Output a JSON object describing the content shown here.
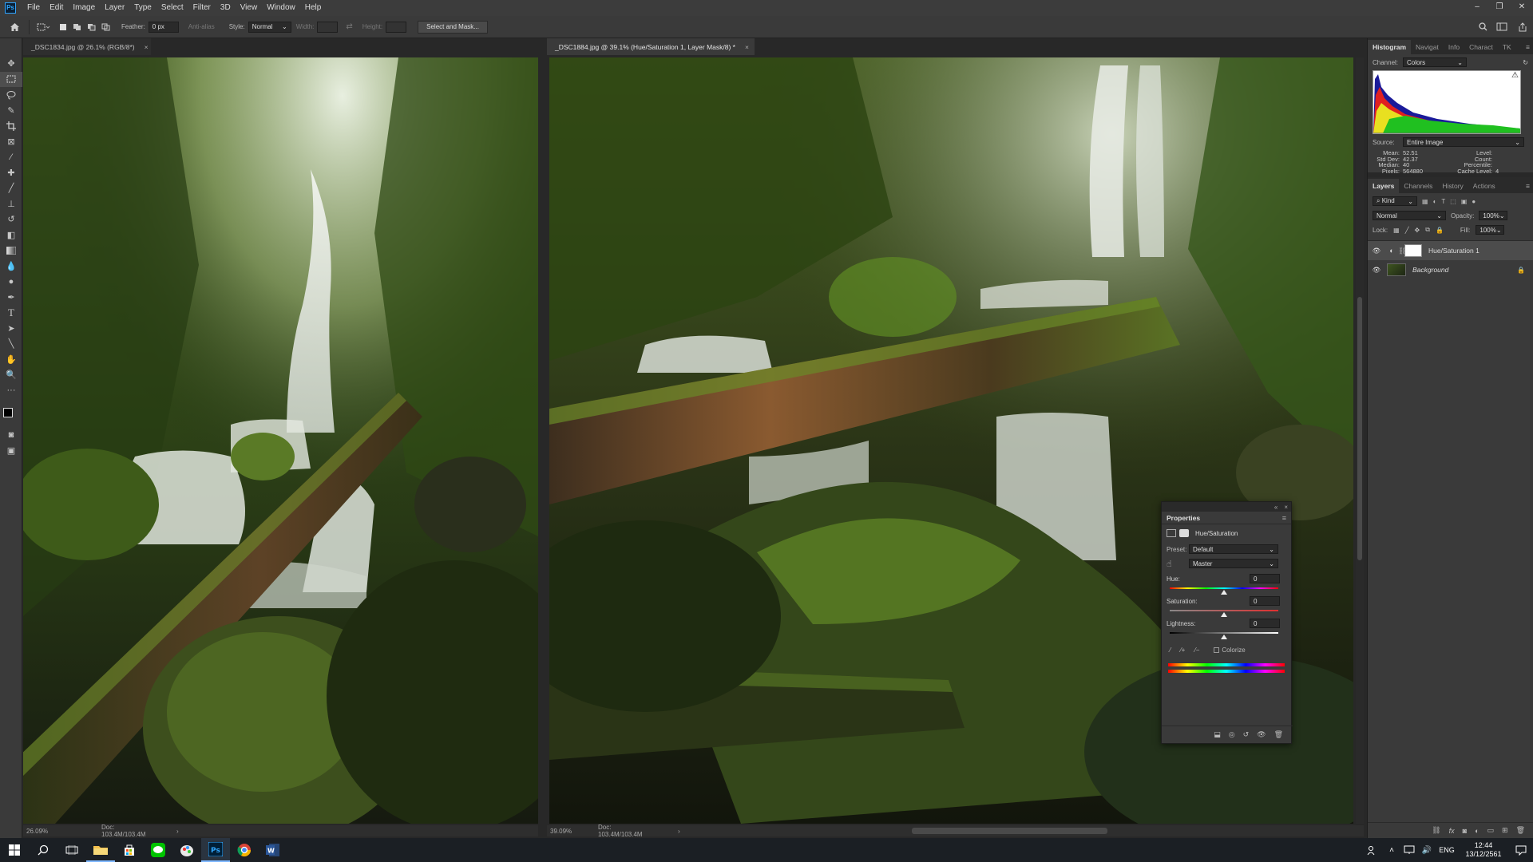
{
  "app": {
    "logo_text": "Ps"
  },
  "menu": [
    "File",
    "Edit",
    "Image",
    "Layer",
    "Type",
    "Select",
    "Filter",
    "3D",
    "View",
    "Window",
    "Help"
  ],
  "window_controls": {
    "minimize": "–",
    "restore": "❐",
    "close": "✕"
  },
  "options_bar": {
    "feather_label": "Feather:",
    "feather_value": "0 px",
    "anti_alias_label": "Anti-alias",
    "style_label": "Style:",
    "style_value": "Normal",
    "width_label": "Width:",
    "height_label": "Height:",
    "select_mask_label": "Select and Mask..."
  },
  "documents": [
    {
      "tab_title": "_DSC1834.jpg @ 26.1% (RGB/8*)",
      "close": "×",
      "zoom": "26.09%",
      "doc_info": "Doc: 103.4M/103.4M",
      "arrow": "›",
      "active": false
    },
    {
      "tab_title": "_DSC1884.jpg @ 39.1% (Hue/Saturation 1, Layer Mask/8) *",
      "close": "×",
      "zoom": "39.09%",
      "doc_info": "Doc: 103.4M/103.4M",
      "arrow": "›",
      "active": true
    }
  ],
  "histogram_panel": {
    "tabs": [
      "Histogram",
      "Navigat",
      "Info",
      "Charact",
      "TK Rapi"
    ],
    "channel_label": "Channel:",
    "channel_value": "Colors",
    "source_label": "Source:",
    "source_value": "Entire Image",
    "stats_left": [
      {
        "label": "Mean:",
        "value": "52.51"
      },
      {
        "label": "Std Dev:",
        "value": "42.37"
      },
      {
        "label": "Median:",
        "value": "40"
      },
      {
        "label": "Pixels:",
        "value": "564880"
      }
    ],
    "stats_right": [
      {
        "label": "Level:",
        "value": ""
      },
      {
        "label": "Count:",
        "value": ""
      },
      {
        "label": "Percentile:",
        "value": ""
      },
      {
        "label": "Cache Level:",
        "value": "4"
      }
    ],
    "warning_icon": "⚠"
  },
  "layers_panel": {
    "tabs": [
      "Layers",
      "Channels",
      "History",
      "Actions"
    ],
    "filter_kind": "Kind",
    "blend_mode": "Normal",
    "opacity_label": "Opacity:",
    "opacity_value": "100%",
    "lock_label": "Lock:",
    "fill_label": "Fill:",
    "fill_value": "100%",
    "layers": [
      {
        "name": "Hue/Saturation 1",
        "visible": true,
        "selected": true
      },
      {
        "name": "Background",
        "visible": true,
        "selected": false,
        "locked": true
      }
    ],
    "footer_icons": [
      "link-icon",
      "fx-icon",
      "mask-icon",
      "adjustment-icon",
      "group-icon",
      "new-layer-icon",
      "trash-icon"
    ]
  },
  "properties": {
    "title": "Properties",
    "subtitle": "Hue/Saturation",
    "preset_label": "Preset:",
    "preset_value": "Default",
    "range_value": "Master",
    "hue_label": "Hue:",
    "hue_value": "0",
    "saturation_label": "Saturation:",
    "saturation_value": "0",
    "lightness_label": "Lightness:",
    "lightness_value": "0",
    "colorize_label": "Colorize",
    "colorize_checked": false
  },
  "taskbar": {
    "apps": [
      "start",
      "search",
      "task-view",
      "file-explorer",
      "store",
      "line",
      "paint-app",
      "photoshop",
      "chrome",
      "word"
    ],
    "language": "ENG",
    "time": "12:44",
    "date": "13/12/2561"
  }
}
